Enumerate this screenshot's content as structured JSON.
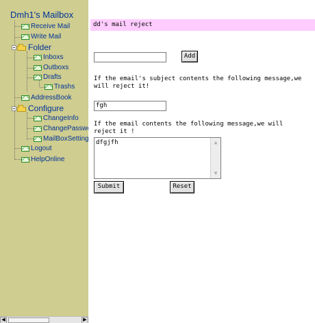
{
  "sidebar": {
    "title": "Dmh1's Mailbox",
    "items": [
      {
        "label": "Receive Mail",
        "icon": "envelope-icon"
      },
      {
        "label": "Write Mail",
        "icon": "envelope-icon"
      },
      {
        "label": "Folder",
        "icon": "folder-icon"
      },
      {
        "label": "Inboxs",
        "icon": "envelope-icon"
      },
      {
        "label": "Outboxs",
        "icon": "envelope-icon"
      },
      {
        "label": "Drafts",
        "icon": "envelope-icon"
      },
      {
        "label": "Trashs",
        "icon": "envelope-icon"
      },
      {
        "label": "AddressBook",
        "icon": "envelope-icon"
      },
      {
        "label": "Configure",
        "icon": "folder-icon"
      },
      {
        "label": "ChangeInfo",
        "icon": "envelope-icon"
      },
      {
        "label": "ChangePasswo",
        "icon": "envelope-icon"
      },
      {
        "label": "MailBoxSetting",
        "icon": "envelope-icon"
      },
      {
        "label": "Logout",
        "icon": "envelope-icon"
      },
      {
        "label": "HelpOnline",
        "icon": "envelope-icon"
      }
    ],
    "scroll_left": "◀",
    "scroll_right": "▶"
  },
  "main": {
    "header": "dd's mail reject",
    "add_input_value": "",
    "add_button": "Add",
    "subject_note": "If the email's subject contents the following message,we will reject it!",
    "subject_value": "fgh",
    "content_note": "If the email contents the following message,we will reject it !",
    "content_value": "dfgjfh",
    "submit_button": "Submit",
    "reset_button": "Reset",
    "textarea_up": "▲",
    "textarea_down": "▼"
  },
  "colors": {
    "sidebar_bg": "#cfcd8f",
    "header_bg": "#ffccff",
    "link_color": "#003399"
  }
}
